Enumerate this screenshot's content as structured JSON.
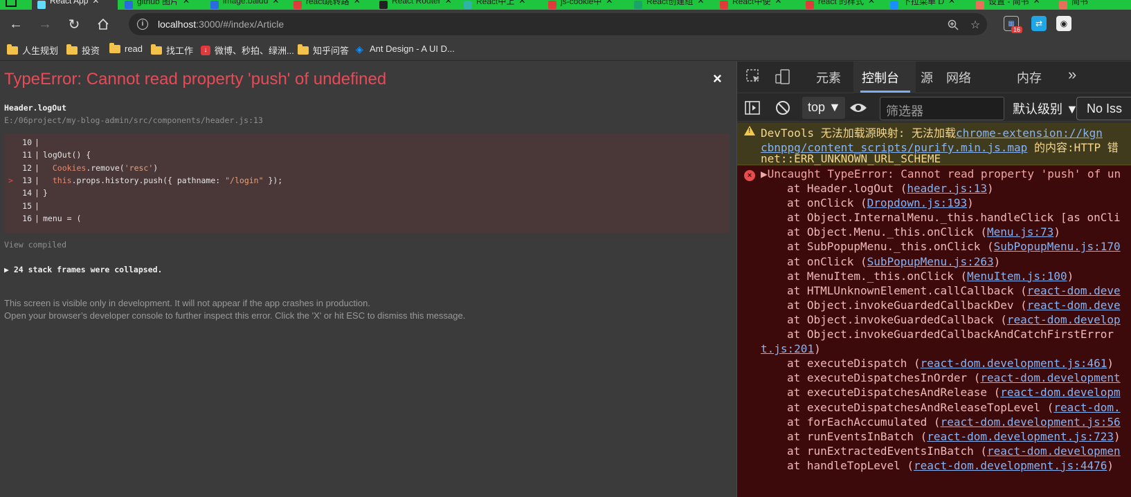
{
  "browser": {
    "tabs": [
      {
        "title": "React App",
        "color": "#61dafb",
        "active": true
      },
      {
        "title": "github 图片",
        "color": "#2b6be0"
      },
      {
        "title": "image.baidu",
        "color": "#2b6be0"
      },
      {
        "title": "react跳转路",
        "color": "#e03b3b"
      },
      {
        "title": "React Router",
        "color": "#222222"
      },
      {
        "title": "React中上",
        "color": "#2fb3a4"
      },
      {
        "title": "js-cookie中",
        "color": "#e03b3b"
      },
      {
        "title": "React创建组",
        "color": "#1aa36b"
      },
      {
        "title": "React中使",
        "color": "#e03b3b"
      },
      {
        "title": "react 的样式",
        "color": "#e03b3b"
      },
      {
        "title": "下拉菜单 D",
        "color": "#1890ff"
      },
      {
        "title": "设置 - 简书",
        "color": "#ea6f5a"
      },
      {
        "title": "简书",
        "color": "#ea6f5a"
      }
    ],
    "url_host": "localhost",
    "url_path": ":3000/#/index/Article",
    "extension_badge": "16",
    "bookmarks": [
      {
        "label": "人生规划",
        "type": "folder"
      },
      {
        "label": "投资",
        "type": "folder"
      },
      {
        "label": "read",
        "type": "folder"
      },
      {
        "label": "找工作",
        "type": "folder"
      },
      {
        "label": "微博、秒拍、绿洲...",
        "type": "weibo"
      },
      {
        "label": "知乎问答",
        "type": "folder"
      },
      {
        "label": "Ant Design - A UI D...",
        "type": "ant"
      }
    ]
  },
  "overlay": {
    "title": "TypeError: Cannot read property 'push' of undefined",
    "close": "×",
    "frame_function": "Header.logOut",
    "frame_file": "E:/06project/my-blog-admin/src/components/header.js:13",
    "code_lines": [
      {
        "num": "10",
        "text": ""
      },
      {
        "num": "11",
        "text": "logOut() {"
      },
      {
        "num": "12",
        "text": "  Cookies.remove('resc')"
      },
      {
        "num": "13",
        "text": "  this.props.history.push({ pathname: \"/login\" });",
        "highlight": true
      },
      {
        "num": "14",
        "text": "}"
      },
      {
        "num": "15",
        "text": ""
      },
      {
        "num": "16",
        "text": "menu = ("
      }
    ],
    "view_compiled": "View compiled",
    "collapsed": "▶ 24 stack frames were collapsed.",
    "note_line1": "This screen is visible only in development. It will not appear if the app crashes in production.",
    "note_line2": "Open your browser’s developer console to further inspect this error.  Click the 'X' or hit ESC to dismiss this message."
  },
  "devtools": {
    "tabs": [
      "元素",
      "控制台",
      "源",
      "网络",
      "内存"
    ],
    "active_tab": "控制台",
    "more": "»",
    "context": "top",
    "filter_placeholder": "筛选器",
    "level": "默认级别 ▼",
    "issues": "No Iss",
    "warning": {
      "line1_prefix": "DevTools 无法加载源映射:  无法加载",
      "line1_link": "chrome-extension://kgn",
      "line2_link": "cbnppg/content_scripts/purify.min.js.map",
      "line2_suffix": " 的内容:HTTP 错",
      "line3": "net::ERR_UNKNOWN_URL_SCHEME"
    },
    "error_head": "▶Uncaught TypeError: Cannot read property 'push' of un",
    "stack": [
      {
        "text": "at Header.logOut (",
        "link": "header.js:13",
        "tail": ")"
      },
      {
        "text": "at onClick (",
        "link": "Dropdown.js:193",
        "tail": ")"
      },
      {
        "text": "at Object.InternalMenu._this.handleClick [as onCli",
        "link": "",
        "tail": ""
      },
      {
        "text": "at Object.Menu._this.onClick (",
        "link": "Menu.js:73",
        "tail": ")"
      },
      {
        "text": "at SubPopupMenu._this.onClick (",
        "link": "SubPopupMenu.js:170",
        "tail": ""
      },
      {
        "text": "at onClick (",
        "link": "SubPopupMenu.js:263",
        "tail": ")"
      },
      {
        "text": "at MenuItem._this.onClick (",
        "link": "MenuItem.js:100",
        "tail": ")"
      },
      {
        "text": "at HTMLUnknownElement.callCallback (",
        "link": "react-dom.deve",
        "tail": ""
      },
      {
        "text": "at Object.invokeGuardedCallbackDev (",
        "link": "react-dom.deve",
        "tail": ""
      },
      {
        "text": "at Object.invokeGuardedCallback (",
        "link": "react-dom.develop",
        "tail": ""
      },
      {
        "text": "at Object.invokeGuardedCallbackAndCatchFirstError",
        "link": "",
        "tail": ""
      },
      {
        "text": "",
        "link": "t.js:201",
        "tail": ")",
        "wrap": true
      },
      {
        "text": "at executeDispatch (",
        "link": "react-dom.development.js:461",
        "tail": ")"
      },
      {
        "text": "at executeDispatchesInOrder (",
        "link": "react-dom.development",
        "tail": ""
      },
      {
        "text": "at executeDispatchesAndRelease (",
        "link": "react-dom.developm",
        "tail": ""
      },
      {
        "text": "at executeDispatchesAndReleaseTopLevel (",
        "link": "react-dom.",
        "tail": ""
      },
      {
        "text": "at forEachAccumulated (",
        "link": "react-dom.development.js:56",
        "tail": ""
      },
      {
        "text": "at runEventsInBatch (",
        "link": "react-dom.development.js:723",
        "tail": ")"
      },
      {
        "text": "at runExtractedEventsInBatch (",
        "link": "react-dom.developmen",
        "tail": ""
      },
      {
        "text": "at handleTopLevel (",
        "link": "react-dom.development.js:4476",
        "tail": ")"
      }
    ]
  }
}
